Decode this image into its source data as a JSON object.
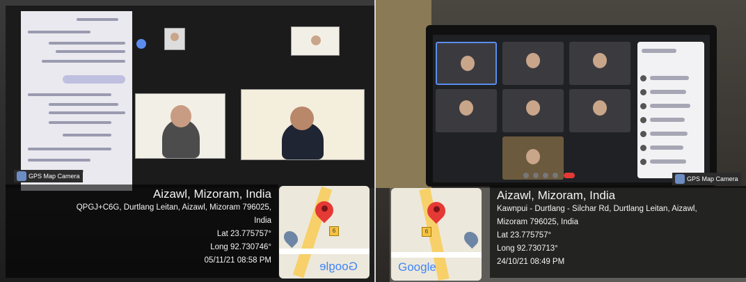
{
  "left_photo": {
    "camera_badge": "GPS Map Camera",
    "location_title": "Aizawl, Mizoram, India",
    "address_line1": "QPGJ+C6G, Durtlang Leitan, Aizawl, Mizoram 796025,",
    "address_line2": "India",
    "lat": "Lat 23.775757°",
    "long": "Long 92.730746°",
    "datetime": "05/11/21 08:58 PM",
    "map_road_number": "6",
    "map_logo": "Google"
  },
  "right_photo": {
    "camera_badge": "GPS Map Camera",
    "location_title": "Aizawl, Mizoram, India",
    "address_line1": "Kawnpui - Durtlang - Silchar Rd, Durtlang Leitan, Aizawl,",
    "address_line2": "Mizoram 796025, India",
    "lat": "Lat 23.775757°",
    "long": "Long 92.730713°",
    "datetime": "24/10/21 08:49 PM",
    "map_road_number": "6",
    "map_logo": "Google"
  },
  "colors": {
    "pin": "#e53935",
    "google_blue": "#4285f4",
    "google_red": "#ea4335",
    "google_yellow": "#fbbc05",
    "google_green": "#34a853"
  }
}
